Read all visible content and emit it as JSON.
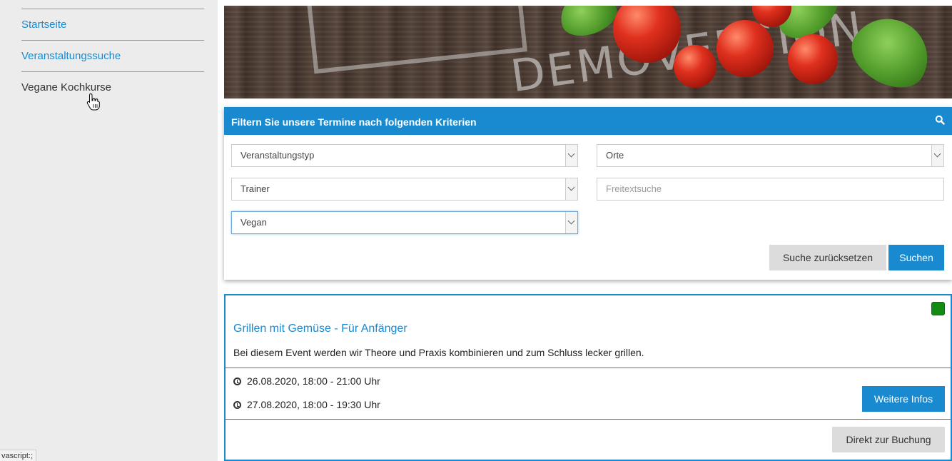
{
  "sidebar": {
    "items": [
      {
        "label": "Startseite",
        "state": "link"
      },
      {
        "label": "Veranstaltungssuche",
        "state": "link"
      },
      {
        "label": "Vegane Kochkurse",
        "state": "active"
      }
    ],
    "status_bar_text": "vascript:;"
  },
  "hero": {
    "watermark_text": "DEMOVERSION"
  },
  "filter": {
    "title": "Filtern Sie unsere Termine nach folgenden Kriterien",
    "search_icon": "search-icon",
    "event_type_select": {
      "value": "Veranstaltungstyp"
    },
    "location_select": {
      "value": "Orte"
    },
    "trainer_select": {
      "value": "Trainer"
    },
    "freetext_input": {
      "placeholder": "Freitextsuche",
      "value": ""
    },
    "category_select": {
      "value": "Vegan"
    },
    "reset_label": "Suche zurücksetzen",
    "search_label": "Suchen"
  },
  "event": {
    "status_color": "#138a13",
    "title": "Grillen mit Gemüse - Für Anfänger",
    "description": "Bei diesem Event werden wir Theore und Praxis kombinieren und zum Schluss lecker grillen.",
    "dates": [
      "26.08.2020, 18:00 - 21:00 Uhr",
      "27.08.2020, 18:00 - 19:30 Uhr"
    ],
    "more_info_label": "Weitere Infos",
    "booking_label": "Direkt zur Buchung"
  },
  "colors": {
    "accent": "#1a8ad0",
    "sidebar_bg": "#ececec",
    "button_grey": "#dcdcdc"
  }
}
